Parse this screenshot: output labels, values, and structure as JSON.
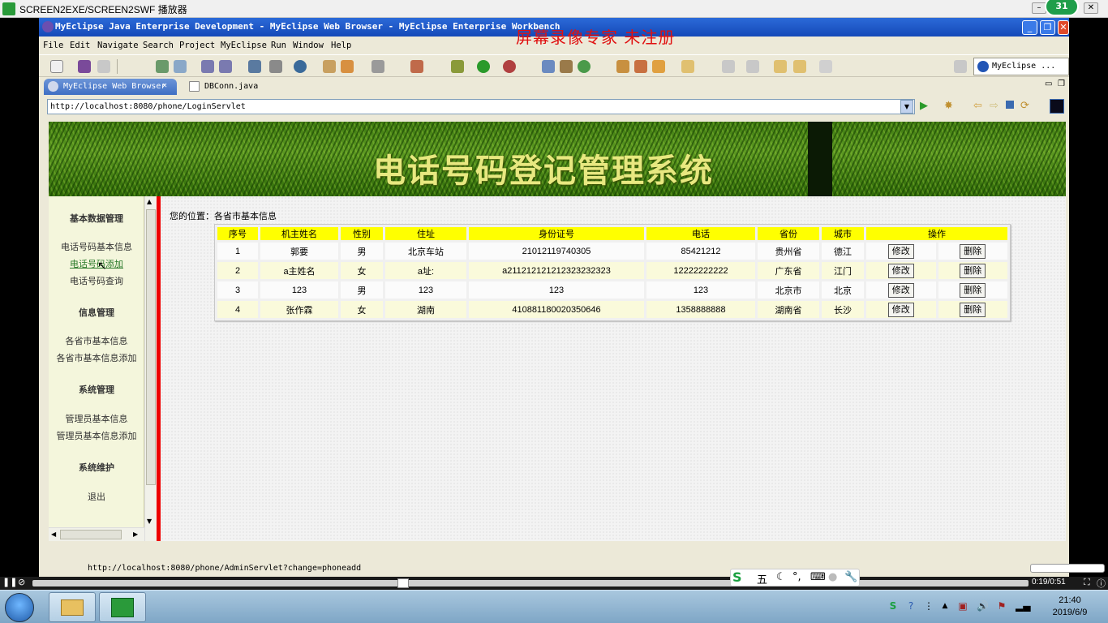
{
  "player": {
    "title": "SCREEN2EXE/SCREEN2SWF 播放器",
    "badge": "31",
    "time": "0:19/0:51"
  },
  "eclipse": {
    "title": "MyEclipse Java Enterprise Development - MyEclipse Web Browser - MyEclipse Enterprise Workbench",
    "watermark": "屏幕录像专家  未注册",
    "menu": [
      "File",
      "Edit",
      "Navigate",
      "Search",
      "Project",
      "MyEclipse",
      "Run",
      "Window",
      "Help"
    ],
    "perspective": "MyEclipse ...",
    "tabs": [
      {
        "label": "MyEclipse Web Browser",
        "close": "✕"
      },
      {
        "label": "DBConn.java"
      }
    ],
    "url": "http://localhost:8080/phone/LoginServlet",
    "status_url": "http://localhost:8080/phone/AdminServlet?change=phoneadd"
  },
  "page": {
    "banner_title": "电话号码登记管理系统",
    "location": "您的位置：各省市基本信息",
    "sidebar": {
      "sections": [
        {
          "heading": "基本数据管理",
          "items": [
            "电话号码基本信息",
            "电话号码添加",
            "电话号码查询"
          ]
        },
        {
          "heading": "信息管理",
          "items": [
            "各省市基本信息",
            "各省市基本信息添加"
          ]
        },
        {
          "heading": "系统管理",
          "items": [
            "管理员基本信息",
            "管理员基本信息添加"
          ]
        },
        {
          "heading": "系统维护",
          "items": [
            "退出"
          ]
        }
      ]
    },
    "table": {
      "headers": [
        "序号",
        "机主姓名",
        "性别",
        "住址",
        "身份证号",
        "电话",
        "省份",
        "城市",
        "操作"
      ],
      "edit_label": "修改",
      "delete_label": "删除",
      "rows": [
        [
          "1",
          "郭要",
          "男",
          "北京车站",
          "21012119740305",
          "85421212",
          "贵州省",
          "德江"
        ],
        [
          "2",
          "a主姓名",
          "女",
          "a址:",
          "a211212121212323232323",
          "12222222222",
          "广东省",
          "江门"
        ],
        [
          "3",
          "123",
          "男",
          "123",
          "123",
          "123",
          "北京市",
          "北京"
        ],
        [
          "4",
          "张作霖",
          "女",
          "湖南",
          "410881180020350646",
          "1358888888",
          "湖南省",
          "长沙"
        ]
      ]
    }
  },
  "taskbar": {
    "time": "21:40",
    "date": "2019/6/9"
  },
  "colors": {
    "table_header": "#ffff00",
    "accent_red": "#ee0000",
    "title_blue": "#1549b8"
  }
}
